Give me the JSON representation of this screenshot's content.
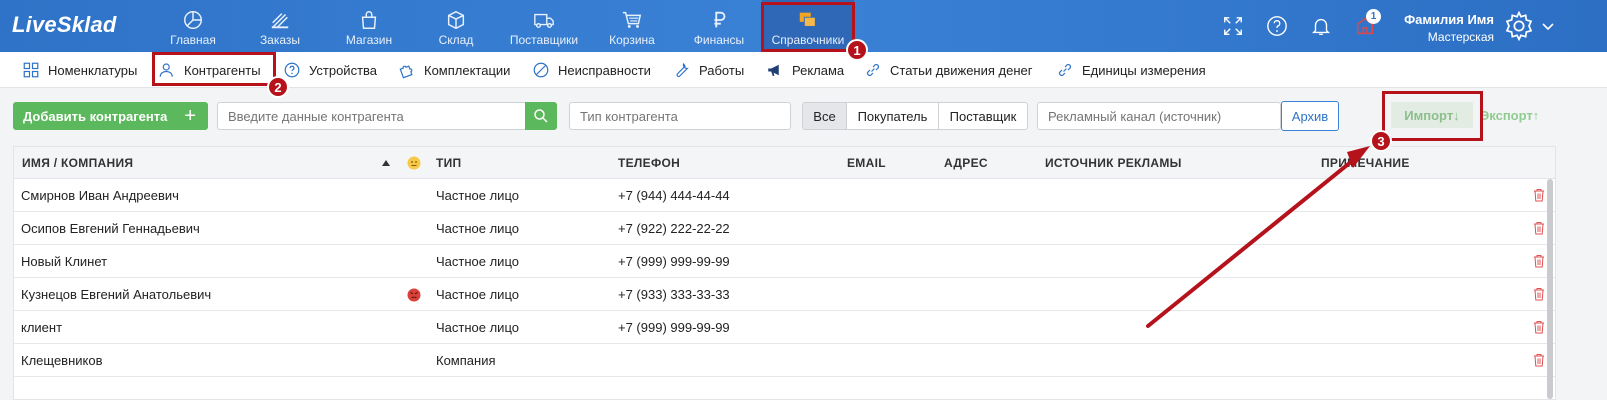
{
  "app": {
    "logo": "LiveSklad"
  },
  "nav": [
    {
      "label": "Главная",
      "icon": "pie-chart-icon"
    },
    {
      "label": "Заказы",
      "icon": "orders-icon"
    },
    {
      "label": "Магазин",
      "icon": "shop-bag-icon"
    },
    {
      "label": "Склад",
      "icon": "box-icon"
    },
    {
      "label": "Поставщики",
      "icon": "truck-icon"
    },
    {
      "label": "Корзина",
      "icon": "cart-icon"
    },
    {
      "label": "Финансы",
      "icon": "ruble-icon"
    },
    {
      "label": "Справочники",
      "icon": "reference-books-icon",
      "active": true
    }
  ],
  "user": {
    "name": "Фамилия Имя",
    "role": "Мастерская",
    "notifications": "1"
  },
  "subnav": [
    {
      "label": "Номенклатуры",
      "icon": "nomenclature-icon"
    },
    {
      "label": "Контрагенты",
      "icon": "contractors-icon"
    },
    {
      "label": "Устройства",
      "icon": "question-icon"
    },
    {
      "label": "Комплектации",
      "icon": "puzzle-icon"
    },
    {
      "label": "Неисправности",
      "icon": "forbidden-icon"
    },
    {
      "label": "Работы",
      "icon": "wrench-icon"
    },
    {
      "label": "Реклама",
      "icon": "megaphone-icon"
    },
    {
      "label": "Статьи движения денег",
      "icon": "link-icon"
    },
    {
      "label": "Единицы измерения",
      "icon": "link-icon"
    }
  ],
  "toolbar": {
    "add_label": "Добавить контрагента",
    "search_placeholder": "Введите данные контрагента",
    "type_placeholder": "Тип контрагента",
    "filters": [
      "Все",
      "Покупатель",
      "Поставщик"
    ],
    "ad_channel_placeholder": "Рекламный канал (источник)",
    "archive_label": "Архив",
    "import_label": "Импорт↓",
    "export_label": "Экспорт↑"
  },
  "annotations": [
    "1",
    "2",
    "3"
  ],
  "table": {
    "columns": [
      "ИМЯ / КОМПАНИЯ",
      "ТИП",
      "ТЕЛЕФОН",
      "EMAIL",
      "АДРЕС",
      "ИСТОЧНИК РЕКЛАМЫ",
      "ПРИМЕЧАНИЕ"
    ],
    "rows": [
      {
        "name": "Смирнов Иван Андреевич",
        "type": "Частное лицо",
        "phone": "+7 (944) 444-44-44",
        "mood": ""
      },
      {
        "name": "Осипов Евгений Геннадьевич",
        "type": "Частное лицо",
        "phone": "+7 (922) 222-22-22",
        "mood": ""
      },
      {
        "name": "Новый Клинет",
        "type": "Частное лицо",
        "phone": "+7 (999) 999-99-99",
        "mood": ""
      },
      {
        "name": "Кузнецов Евгений Анатольевич",
        "type": "Частное лицо",
        "phone": "+7 (933) 333-33-33",
        "mood": "angry"
      },
      {
        "name": "клиент",
        "type": "Частное лицо",
        "phone": "+7 (999) 999-99-99",
        "mood": ""
      },
      {
        "name": "Клещевников",
        "type": "Компания",
        "phone": "",
        "mood": ""
      }
    ]
  },
  "colors": {
    "header": "#2f73c8",
    "accent_green": "#5cb85c",
    "annotation_red": "#b5121b"
  }
}
